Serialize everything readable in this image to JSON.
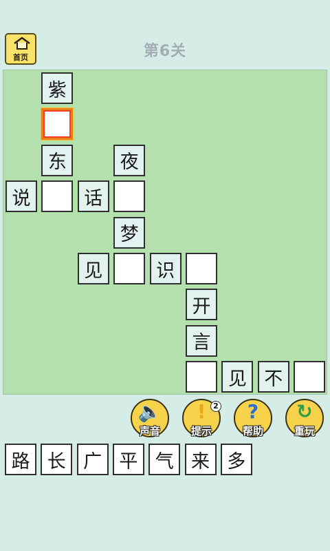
{
  "header": {
    "home_label": "首页",
    "level_title": "第6关"
  },
  "grid": {
    "cells": [
      {
        "row": 0,
        "col": 1,
        "char": "紫"
      },
      {
        "row": 1,
        "col": 1,
        "char": "",
        "selected": true
      },
      {
        "row": 2,
        "col": 1,
        "char": "东"
      },
      {
        "row": 2,
        "col": 3,
        "char": "夜"
      },
      {
        "row": 3,
        "col": 0,
        "char": "说"
      },
      {
        "row": 3,
        "col": 1,
        "char": ""
      },
      {
        "row": 3,
        "col": 2,
        "char": "话"
      },
      {
        "row": 3,
        "col": 3,
        "char": ""
      },
      {
        "row": 4,
        "col": 3,
        "char": "梦"
      },
      {
        "row": 5,
        "col": 2,
        "char": "见"
      },
      {
        "row": 5,
        "col": 3,
        "char": ""
      },
      {
        "row": 5,
        "col": 4,
        "char": "识"
      },
      {
        "row": 5,
        "col": 5,
        "char": ""
      },
      {
        "row": 6,
        "col": 5,
        "char": "开"
      },
      {
        "row": 7,
        "col": 5,
        "char": "言"
      },
      {
        "row": 8,
        "col": 5,
        "char": ""
      },
      {
        "row": 8,
        "col": 6,
        "char": "见"
      },
      {
        "row": 8,
        "col": 7,
        "char": "不"
      },
      {
        "row": 8,
        "col": 8,
        "char": ""
      }
    ]
  },
  "tools": [
    {
      "id": "sound",
      "label": "声音",
      "icon": "speaker-icon",
      "glyph": "🔈",
      "color": "#e04a3a"
    },
    {
      "id": "hint",
      "label": "提示",
      "icon": "exclamation-icon",
      "glyph": "!",
      "color": "#e8a817",
      "badge": "2"
    },
    {
      "id": "help",
      "label": "帮助",
      "icon": "question-icon",
      "glyph": "?",
      "color": "#2a6fd6"
    },
    {
      "id": "replay",
      "label": "重玩",
      "icon": "refresh-icon",
      "glyph": "↻",
      "color": "#2f9e4a"
    }
  ],
  "candidates": [
    "路",
    "长",
    "广",
    "平",
    "气",
    "来",
    "多"
  ]
}
